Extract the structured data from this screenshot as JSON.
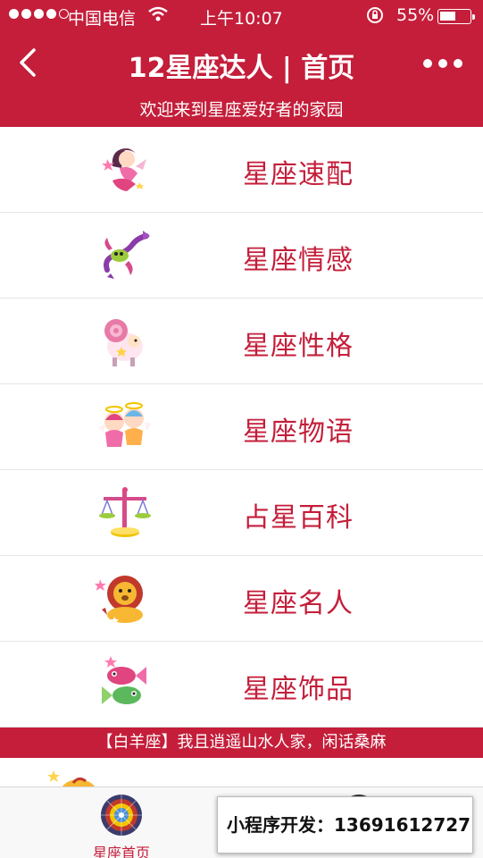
{
  "status_bar": {
    "carrier": "中国电信",
    "time": "上午10:07",
    "battery": "55%",
    "battery_level": 0.55
  },
  "nav": {
    "title": "12星座达人 | 首页"
  },
  "welcome": "欢迎来到星座爱好者的家园",
  "menu": [
    {
      "label": "星座速配",
      "icon": "virgo-fairy-icon"
    },
    {
      "label": "星座情感",
      "icon": "scorpio-icon"
    },
    {
      "label": "星座性格",
      "icon": "aries-ram-icon"
    },
    {
      "label": "星座物语",
      "icon": "gemini-twins-icon"
    },
    {
      "label": "占星百科",
      "icon": "libra-scales-icon"
    },
    {
      "label": "星座名人",
      "icon": "leo-lion-icon"
    },
    {
      "label": "星座饰品",
      "icon": "pisces-fish-icon"
    }
  ],
  "marquee": "【白羊座】我且逍遥山水人家，闲话桑麻",
  "tabbar": {
    "home_label": "星座首页"
  },
  "promo": "小程序开发：13691612727",
  "colors": {
    "brand": "#c41e3a",
    "background": "#ffffff",
    "divider": "#e5e5e5"
  }
}
